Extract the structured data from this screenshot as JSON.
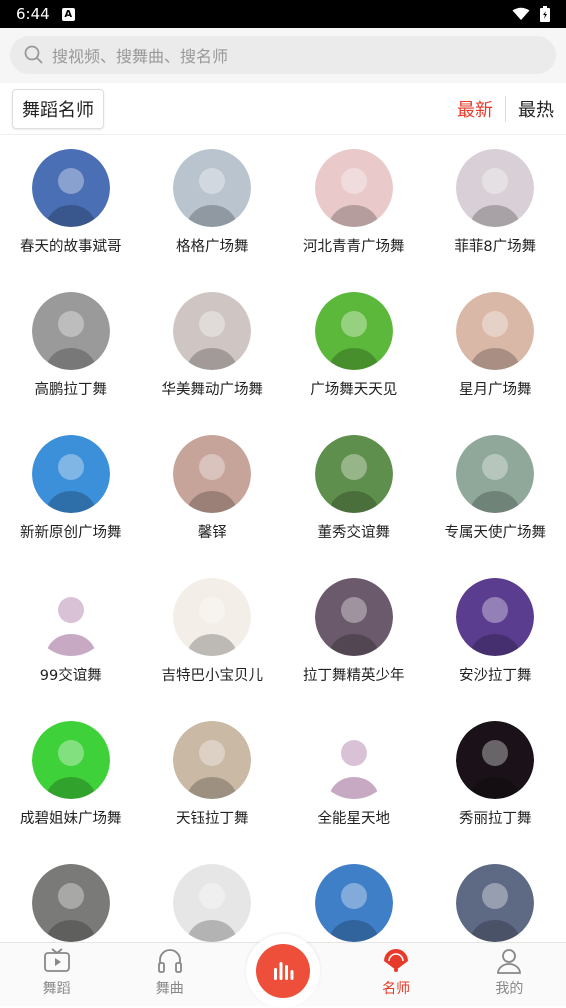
{
  "status": {
    "time": "6:44"
  },
  "search": {
    "placeholder": "搜视频、搜舞曲、搜名师"
  },
  "header": {
    "title": "舞蹈名师",
    "sort_newest": "最新",
    "sort_hot": "最热"
  },
  "teachers": [
    {
      "name": "春天的故事斌哥",
      "color": "#4a6fb5"
    },
    {
      "name": "格格广场舞",
      "color": "#b9c4cf"
    },
    {
      "name": "河北青青广场舞",
      "color": "#e9c9c9"
    },
    {
      "name": "菲菲8广场舞",
      "color": "#d8d0d6"
    },
    {
      "name": "高鹏拉丁舞",
      "color": "#9a9a9a"
    },
    {
      "name": "华美舞动广场舞",
      "color": "#cfc6c3"
    },
    {
      "name": "广场舞天天见",
      "color": "#5cb83a"
    },
    {
      "name": "星月广场舞",
      "color": "#d9b8a8"
    },
    {
      "name": "新新原创广场舞",
      "color": "#3c8fd9"
    },
    {
      "name": "馨铎",
      "color": "#c7a49a"
    },
    {
      "name": "董秀交谊舞",
      "color": "#5f8f4c"
    },
    {
      "name": "专属天使广场舞",
      "color": "#8fa89a"
    },
    {
      "name": "99交谊舞",
      "color": "#ffffff"
    },
    {
      "name": "吉特巴小宝贝儿",
      "color": "#f3eee8"
    },
    {
      "name": "拉丁舞精英少年",
      "color": "#6a5a6b"
    },
    {
      "name": "安沙拉丁舞",
      "color": "#5a3d8f"
    },
    {
      "name": "成碧姐妹广场舞",
      "color": "#3fd13a"
    },
    {
      "name": "天钰拉丁舞",
      "color": "#c9b9a5"
    },
    {
      "name": "全能星天地",
      "color": "#ffffff"
    },
    {
      "name": "秀丽拉丁舞",
      "color": "#1a1218"
    },
    {
      "name": "",
      "color": "#7a7a78"
    },
    {
      "name": "",
      "color": "#e6e6e6"
    },
    {
      "name": "",
      "color": "#3f7fc8"
    },
    {
      "name": "",
      "color": "#5e6a84"
    }
  ],
  "tabs": [
    {
      "label": "舞蹈",
      "icon": "tv-icon"
    },
    {
      "label": "舞曲",
      "icon": "headphones-icon"
    },
    {
      "label": "名师",
      "icon": "fan-icon"
    },
    {
      "label": "我的",
      "icon": "user-icon"
    }
  ]
}
